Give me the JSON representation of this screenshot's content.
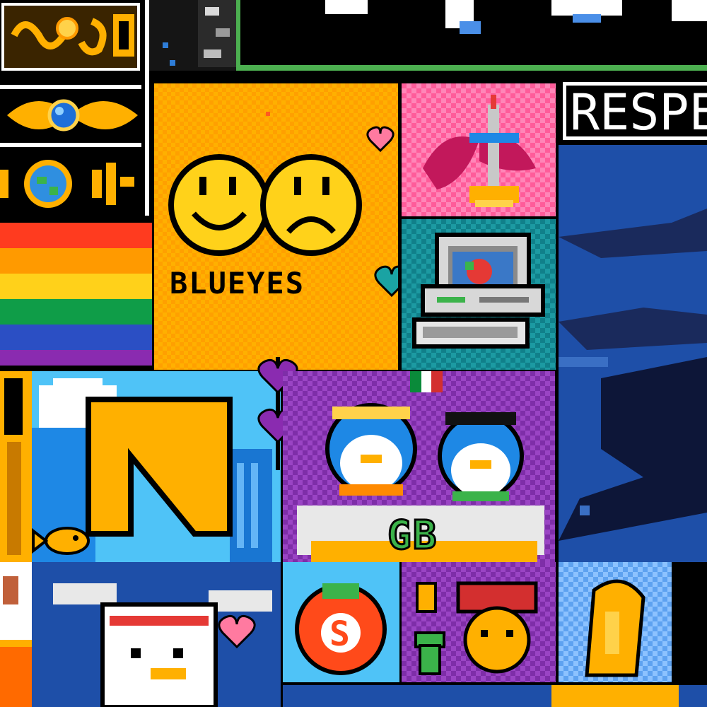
{
  "canvas": {
    "title": "",
    "tiles": {
      "blueyes": {
        "label": "BLUEYES"
      },
      "respect_banner": {
        "label": "RESPE"
      },
      "big_n": {
        "letter": "N"
      },
      "penguins": {
        "letters": "GB"
      },
      "tomato": {
        "letter": "S"
      }
    }
  },
  "colors": {
    "orange": "#ffb000",
    "pink": "#ff5c9a",
    "teal": "#10808a",
    "purple": "#7e2ea8",
    "sky": "#4fc3f7",
    "navy": "#1e4fa8",
    "green_border": "#4caf50",
    "red": "#e53935"
  },
  "icons": [
    "smiley-face-icon",
    "frowny-face-icon",
    "heart-icon",
    "sword-in-stone-icon",
    "retro-computer-icon",
    "rainbow-flag-icon",
    "globe-icon",
    "penguin-icon",
    "tomato-icon",
    "goldfish-icon",
    "coin-icon",
    "warp-pipe-icon",
    "cloud-icon",
    "duck-icon"
  ]
}
